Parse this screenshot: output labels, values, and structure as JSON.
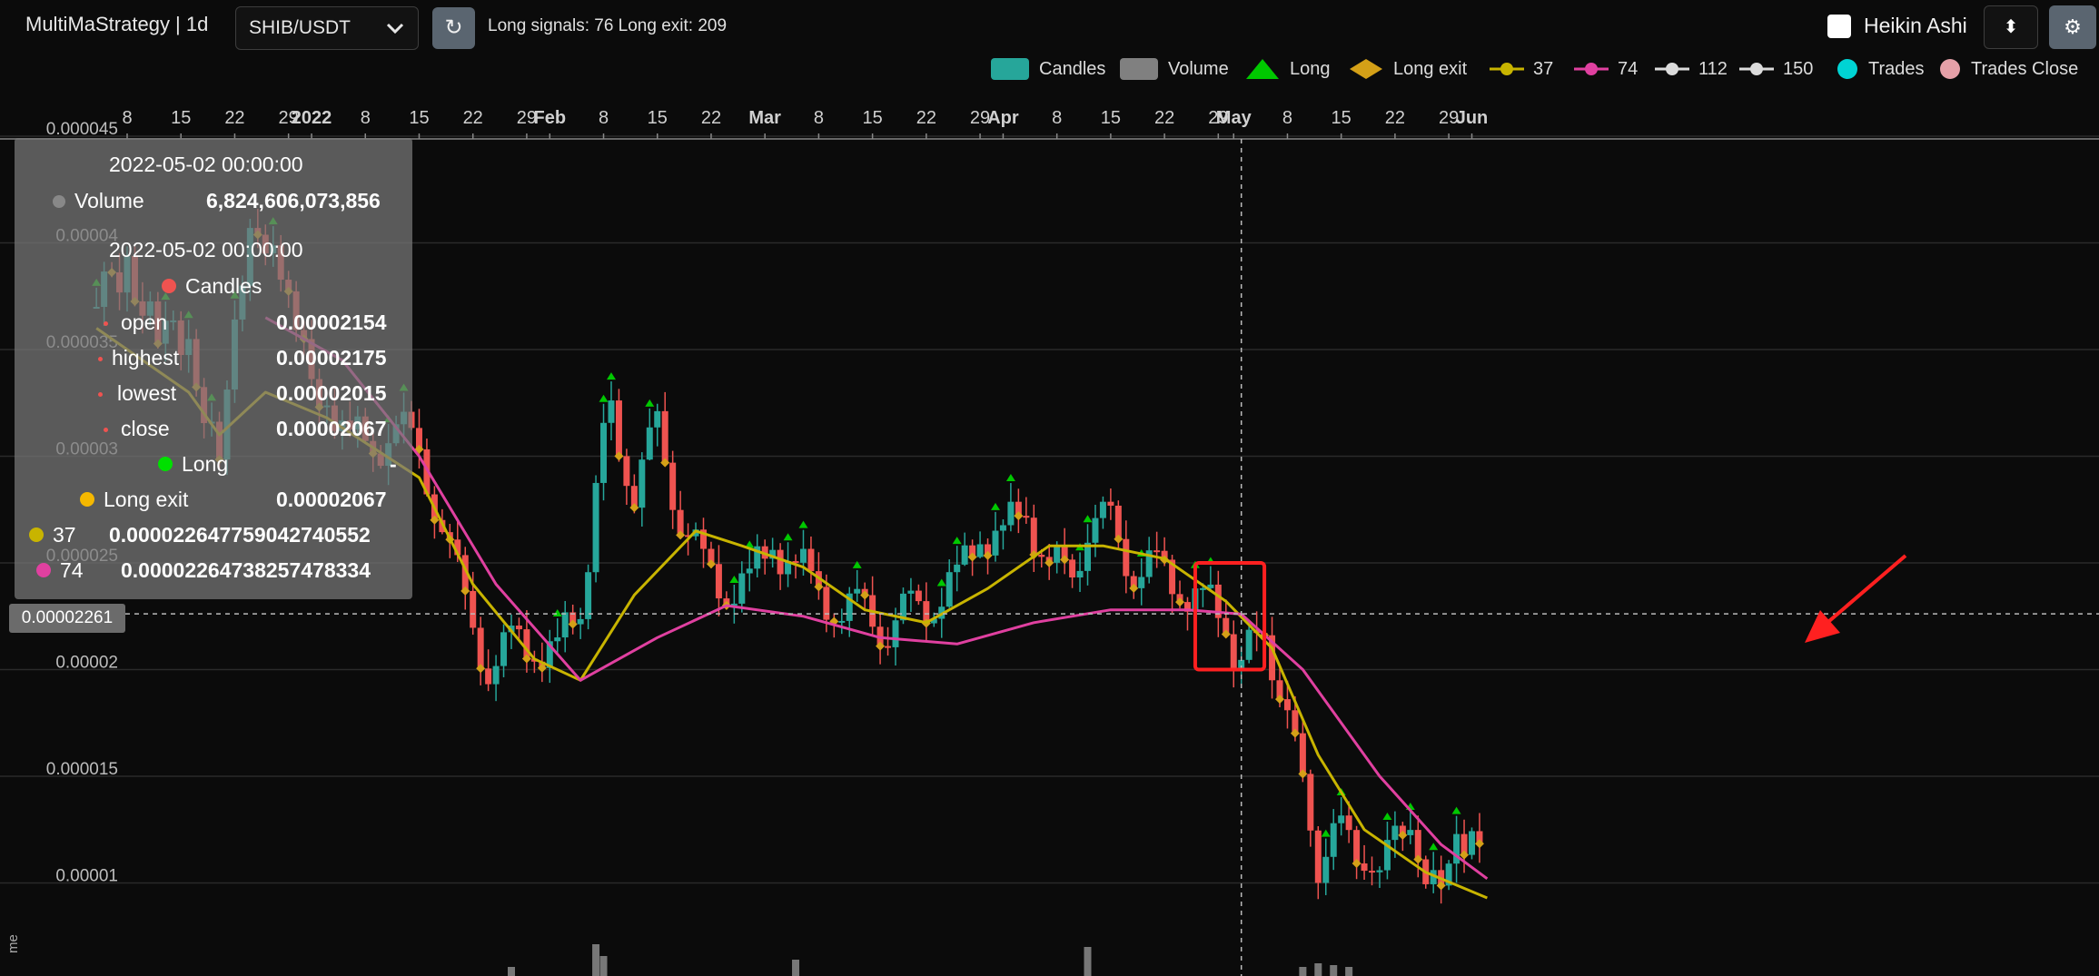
{
  "toolbar": {
    "strategy_title": "MultiMaStrategy | 1d",
    "pair": "SHIB/USDT",
    "refresh_icon": "refresh-icon",
    "signals_text": "Long signals: 76  Long exit: 209",
    "heikin_ashi_label": "Heikin Ashi",
    "sort_icon": "sort-icon",
    "settings_icon": "gear-icon"
  },
  "legend": {
    "items": [
      {
        "label": "Candles",
        "color": "#26a69a",
        "icon": "rect"
      },
      {
        "label": "Volume",
        "color": "#808080",
        "icon": "rect"
      },
      {
        "label": "Long",
        "color": "#00c800",
        "icon": "triangle"
      },
      {
        "label": "Long exit",
        "color": "#d4a017",
        "icon": "diamond"
      },
      {
        "label": "37",
        "color": "#c8b400",
        "icon": "line"
      },
      {
        "label": "74",
        "color": "#e040a0",
        "icon": "line"
      },
      {
        "label": "112",
        "color": "#dcdcdc",
        "icon": "line"
      },
      {
        "label": "150",
        "color": "#dcdcdc",
        "icon": "line"
      },
      {
        "label": "Trades",
        "color": "#00d4d4",
        "icon": "circle"
      },
      {
        "label": "Trades Close",
        "color": "#e6a0a8",
        "icon": "circle"
      }
    ]
  },
  "tooltip": {
    "vol_date": "2022-05-02 00:00:00",
    "vol_label": "Volume",
    "vol_value": "6,824,606,073,856",
    "candle_date": "2022-05-02 00:00:00",
    "candles_label": "Candles",
    "open_label": "open",
    "open_value": "0.00002154",
    "highest_label": "highest",
    "highest_value": "0.00002175",
    "lowest_label": "lowest",
    "lowest_value": "0.00002015",
    "close_label": "close",
    "close_value": "0.00002067",
    "long_label": "Long",
    "long_value": "-",
    "long_exit_label": "Long exit",
    "long_exit_value": "0.00002067",
    "ma37_label": "37",
    "ma37_value": "0.000022647759042740552",
    "ma74_label": "74",
    "ma74_value": "0.00002264738257478334"
  },
  "crosshair_price": "0.00002261",
  "volume_axis_label": "me",
  "colors": {
    "up": "#26a69a",
    "down": "#ef5350",
    "ma37": "#c8b400",
    "ma74": "#e040a0",
    "grid": "#2a2a2a",
    "highlight": "#ff2020"
  },
  "chart_data": {
    "type": "candlestick",
    "title": "",
    "pair": "SHIB/USDT",
    "timeframe": "1d",
    "x_tick_labels": [
      "8",
      "15",
      "22",
      "29",
      "2022",
      "8",
      "15",
      "22",
      "29",
      "Feb",
      "8",
      "15",
      "22",
      "Mar",
      "8",
      "15",
      "22",
      "29",
      "Apr",
      "8",
      "15",
      "22",
      "29",
      "May",
      "8",
      "15",
      "22",
      "29",
      "Jun"
    ],
    "y_tick_labels": [
      "0.000045",
      "0.00004",
      "0.000035",
      "0.00003",
      "0.000025",
      "0.00002",
      "0.000015",
      "0.00001"
    ],
    "ylim": [
      7e-06,
      4.5e-05
    ],
    "grid": true,
    "legend_position": "top-right",
    "series": [
      {
        "name": "Candles",
        "type": "candlestick",
        "close_path": [
          [
            "2021-12-04",
            3.7e-05
          ],
          [
            "2021-12-08",
            3.9e-05
          ],
          [
            "2021-12-12",
            3.6e-05
          ],
          [
            "2021-12-16",
            3.45e-05
          ],
          [
            "2021-12-20",
            3.1e-05
          ],
          [
            "2021-12-24",
            3.95e-05
          ],
          [
            "2021-12-27",
            4.1e-05
          ],
          [
            "2021-12-30",
            3.5e-05
          ],
          [
            "2022-01-03",
            3.3e-05
          ],
          [
            "2022-01-06",
            3.1e-05
          ],
          [
            "2022-01-09",
            3e-05
          ],
          [
            "2022-01-12",
            3.2e-05
          ],
          [
            "2022-01-15",
            2.95e-05
          ],
          [
            "2022-01-18",
            2.75e-05
          ],
          [
            "2022-01-21",
            2.25e-05
          ],
          [
            "2022-01-24",
            2.05e-05
          ],
          [
            "2022-01-27",
            2.1e-05
          ],
          [
            "2022-01-30",
            2.12e-05
          ],
          [
            "2022-02-02",
            2.1e-05
          ],
          [
            "2022-02-05",
            2.25e-05
          ],
          [
            "2022-02-07",
            2.9e-05
          ],
          [
            "2022-02-09",
            3.2e-05
          ],
          [
            "2022-02-12",
            2.85e-05
          ],
          [
            "2022-02-15",
            3.1e-05
          ],
          [
            "2022-02-18",
            2.75e-05
          ],
          [
            "2022-02-21",
            2.45e-05
          ],
          [
            "2022-02-24",
            2.4e-05
          ],
          [
            "2022-02-27",
            2.4e-05
          ],
          [
            "2022-03-02",
            2.6e-05
          ],
          [
            "2022-03-05",
            2.5e-05
          ],
          [
            "2022-03-08",
            2.35e-05
          ],
          [
            "2022-03-11",
            2.3e-05
          ],
          [
            "2022-03-14",
            2.25e-05
          ],
          [
            "2022-03-17",
            2.22e-05
          ],
          [
            "2022-03-20",
            2.25e-05
          ],
          [
            "2022-03-23",
            2.35e-05
          ],
          [
            "2022-03-26",
            2.4e-05
          ],
          [
            "2022-03-29",
            2.65e-05
          ],
          [
            "2022-04-01",
            2.65e-05
          ],
          [
            "2022-04-04",
            2.7e-05
          ],
          [
            "2022-04-07",
            2.55e-05
          ],
          [
            "2022-04-10",
            2.35e-05
          ],
          [
            "2022-04-12",
            2.7e-05
          ],
          [
            "2022-04-15",
            2.65e-05
          ],
          [
            "2022-04-18",
            2.5e-05
          ],
          [
            "2022-04-21",
            2.45e-05
          ],
          [
            "2022-04-24",
            2.4e-05
          ],
          [
            "2022-04-27",
            2.33e-05
          ],
          [
            "2022-04-30",
            2.18e-05
          ],
          [
            "2022-05-02",
            2.07e-05
          ],
          [
            "2022-05-05",
            2.1e-05
          ],
          [
            "2022-05-08",
            1.9e-05
          ],
          [
            "2022-05-10",
            1.4e-05
          ],
          [
            "2022-05-12",
            1.12e-05
          ],
          [
            "2022-05-15",
            1.2e-05
          ],
          [
            "2022-05-19",
            1.15e-05
          ],
          [
            "2022-05-23",
            1.15e-05
          ],
          [
            "2022-05-27",
            1.1e-05
          ],
          [
            "2022-05-31",
            1.13e-05
          ],
          [
            "2022-06-03",
            1.12e-05
          ]
        ]
      },
      {
        "name": "37",
        "type": "line",
        "values": [
          [
            "2021-12-04",
            3.6e-05
          ],
          [
            "2021-12-16",
            3.3e-05
          ],
          [
            "2021-12-20",
            3.1e-05
          ],
          [
            "2021-12-26",
            3.3e-05
          ],
          [
            "2022-01-03",
            3.18e-05
          ],
          [
            "2022-01-15",
            2.9e-05
          ],
          [
            "2022-01-22",
            2.4e-05
          ],
          [
            "2022-01-30",
            2.05e-05
          ],
          [
            "2022-02-05",
            1.95e-05
          ],
          [
            "2022-02-12",
            2.35e-05
          ],
          [
            "2022-02-20",
            2.65e-05
          ],
          [
            "2022-02-26",
            2.58e-05
          ],
          [
            "2022-03-06",
            2.48e-05
          ],
          [
            "2022-03-14",
            2.28e-05
          ],
          [
            "2022-03-22",
            2.22e-05
          ],
          [
            "2022-03-30",
            2.38e-05
          ],
          [
            "2022-04-07",
            2.58e-05
          ],
          [
            "2022-04-14",
            2.58e-05
          ],
          [
            "2022-04-22",
            2.52e-05
          ],
          [
            "2022-04-30",
            2.32e-05
          ],
          [
            "2022-05-06",
            2.1e-05
          ],
          [
            "2022-05-12",
            1.6e-05
          ],
          [
            "2022-05-18",
            1.25e-05
          ],
          [
            "2022-05-26",
            1.05e-05
          ],
          [
            "2022-06-03",
            9.3e-06
          ]
        ]
      },
      {
        "name": "74",
        "type": "line",
        "values": [
          [
            "2021-12-26",
            3.65e-05
          ],
          [
            "2022-01-05",
            3.45e-05
          ],
          [
            "2022-01-15",
            3e-05
          ],
          [
            "2022-01-25",
            2.4e-05
          ],
          [
            "2022-02-05",
            1.95e-05
          ],
          [
            "2022-02-15",
            2.15e-05
          ],
          [
            "2022-02-24",
            2.3e-05
          ],
          [
            "2022-03-06",
            2.25e-05
          ],
          [
            "2022-03-16",
            2.15e-05
          ],
          [
            "2022-03-26",
            2.12e-05
          ],
          [
            "2022-04-05",
            2.22e-05
          ],
          [
            "2022-04-15",
            2.28e-05
          ],
          [
            "2022-04-25",
            2.28e-05
          ],
          [
            "2022-05-02",
            2.26e-05
          ],
          [
            "2022-05-10",
            2e-05
          ],
          [
            "2022-05-20",
            1.5e-05
          ],
          [
            "2022-05-28",
            1.18e-05
          ],
          [
            "2022-06-03",
            1.02e-05
          ]
        ]
      }
    ]
  }
}
